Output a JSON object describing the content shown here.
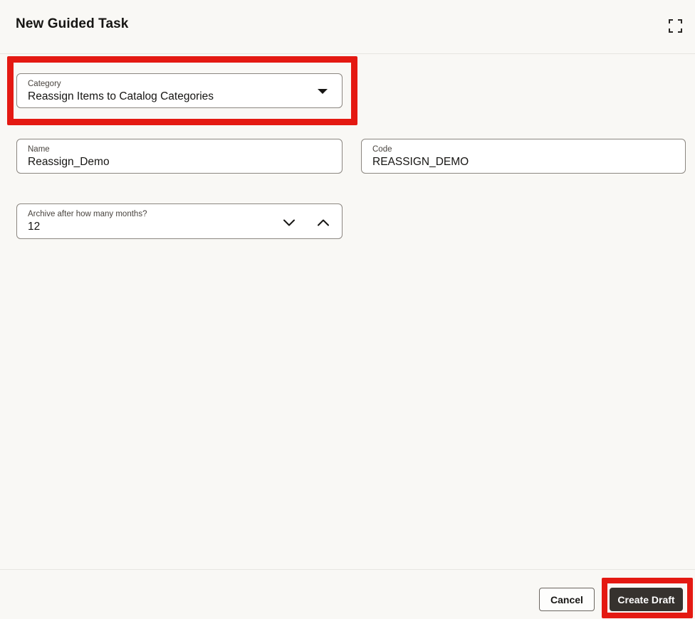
{
  "header": {
    "title": "New Guided Task"
  },
  "icons": {
    "expand": "expand-fullscreen-corners",
    "category_dropdown": "caret-down-filled",
    "stepper_down": "chevron-down",
    "stepper_up": "chevron-up"
  },
  "fields": {
    "category": {
      "label": "Category",
      "value": "Reassign Items to Catalog Categories"
    },
    "name": {
      "label": "Name",
      "value": "Reassign_Demo"
    },
    "code": {
      "label": "Code",
      "value": "REASSIGN_DEMO"
    },
    "archive": {
      "label": "Archive after how many months?",
      "value": "12"
    }
  },
  "footer": {
    "cancel_label": "Cancel",
    "create_label": "Create Draft"
  },
  "annotations": {
    "color": "#e41912",
    "highlighted": [
      "category-field",
      "create-draft-button"
    ]
  },
  "colors": {
    "background": "#f9f8f5",
    "field_border": "#8b8680",
    "primary_button": "#36322e",
    "divider": "#e7e5e1",
    "text": "#161513",
    "label_text": "#49443f"
  }
}
